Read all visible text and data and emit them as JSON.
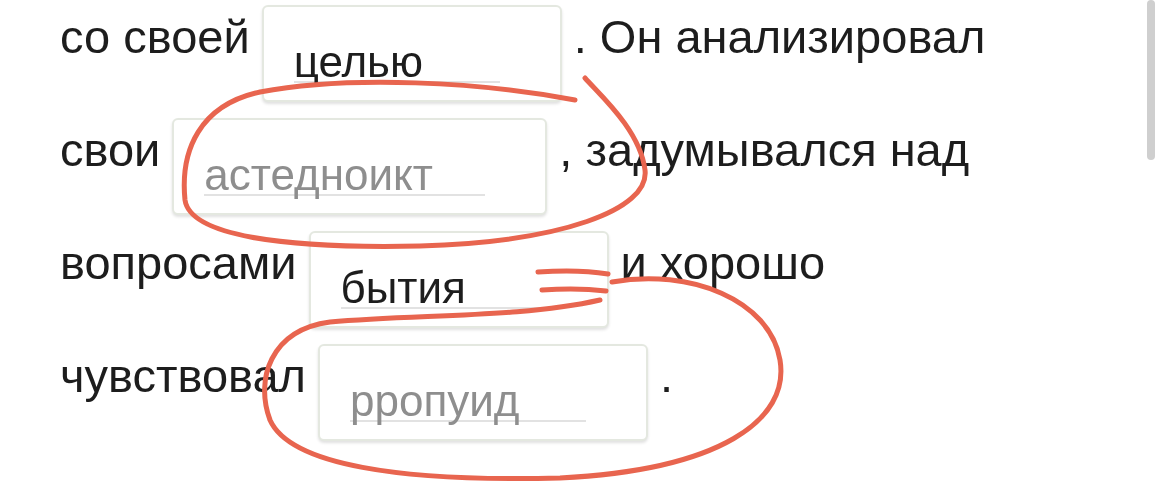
{
  "lines": [
    {
      "segments": [
        {
          "kind": "text",
          "text": "со своей"
        },
        {
          "kind": "blank",
          "value": "целью"
        },
        {
          "kind": "text",
          "text": ". Он анализировал"
        }
      ]
    },
    {
      "segments": [
        {
          "kind": "text",
          "text": "свои"
        },
        {
          "kind": "blank",
          "placeholder": "астедноикт"
        },
        {
          "kind": "text",
          "text": ", задумывался над"
        }
      ]
    },
    {
      "segments": [
        {
          "kind": "text",
          "text": "вопросами"
        },
        {
          "kind": "blank",
          "value": "бытия"
        },
        {
          "kind": "text",
          "text": "и хорошо"
        }
      ]
    },
    {
      "segments": [
        {
          "kind": "text",
          "text": "чувствовал"
        },
        {
          "kind": "blank",
          "placeholder": "рропуид"
        },
        {
          "kind": "text",
          "text": "."
        }
      ]
    }
  ]
}
